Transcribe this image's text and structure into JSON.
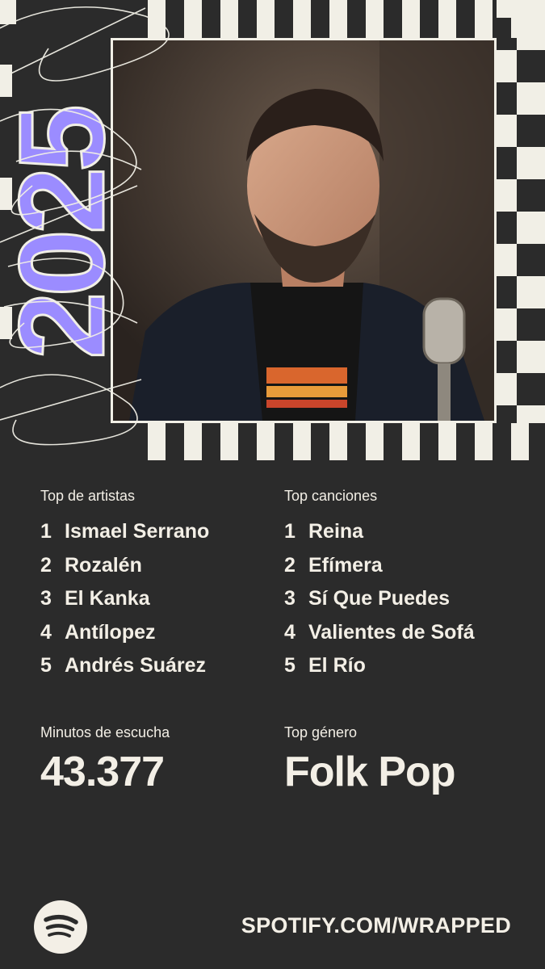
{
  "year": "2025",
  "top_artists": {
    "title": "Top de artistas",
    "items": [
      {
        "rank": "1",
        "name": "Ismael Serrano"
      },
      {
        "rank": "2",
        "name": "Rozalén"
      },
      {
        "rank": "3",
        "name": "El Kanka"
      },
      {
        "rank": "4",
        "name": "Antílopez"
      },
      {
        "rank": "5",
        "name": "Andrés Suárez"
      }
    ]
  },
  "top_songs": {
    "title": "Top canciones",
    "items": [
      {
        "rank": "1",
        "name": "Reina"
      },
      {
        "rank": "2",
        "name": "Efímera"
      },
      {
        "rank": "3",
        "name": "Sí Que Puedes"
      },
      {
        "rank": "4",
        "name": "Valientes de Sofá"
      },
      {
        "rank": "5",
        "name": "El Río"
      }
    ]
  },
  "minutes": {
    "label": "Minutos de escucha",
    "value": "43.377"
  },
  "genre": {
    "label": "Top género",
    "value": "Folk Pop"
  },
  "footer": {
    "url": "SPOTIFY.COM/WRAPPED",
    "logo": "spotify-logo"
  },
  "colors": {
    "background": "#2b2b2b",
    "text": "#f3efe6",
    "accent": "#9b8cff"
  }
}
